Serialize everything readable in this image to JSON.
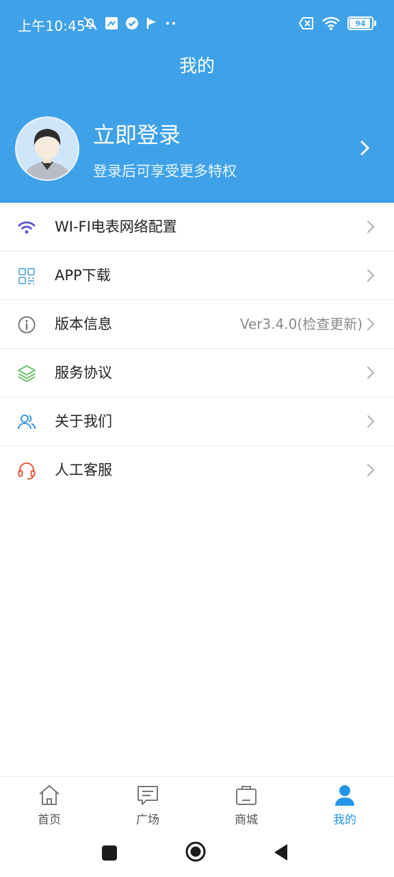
{
  "status_bar": {
    "time": "上午10:45",
    "battery_level": 94,
    "battery_text": "94"
  },
  "header": {
    "title": "我的"
  },
  "profile": {
    "login_title": "立即登录",
    "login_subtitle": "登录后可享受更多特权"
  },
  "menu": {
    "items": [
      {
        "label": "WI-FI电表网络配置",
        "icon": "wifi-icon",
        "value": ""
      },
      {
        "label": "APP下载",
        "icon": "qr-code-icon",
        "value": ""
      },
      {
        "label": "版本信息",
        "icon": "info-icon",
        "value": "Ver3.4.0(检查更新)"
      },
      {
        "label": "服务协议",
        "icon": "layers-icon",
        "value": ""
      },
      {
        "label": "关于我们",
        "icon": "users-icon",
        "value": ""
      },
      {
        "label": "人工客服",
        "icon": "headset-icon",
        "value": ""
      }
    ]
  },
  "tabbar": {
    "tabs": [
      {
        "label": "首页",
        "icon": "home-icon",
        "active": false
      },
      {
        "label": "广场",
        "icon": "chat-icon",
        "active": false
      },
      {
        "label": "商城",
        "icon": "shop-icon",
        "active": false
      },
      {
        "label": "我的",
        "icon": "person-icon",
        "active": true
      }
    ]
  },
  "colors": {
    "header_bg": "#3fa2e9",
    "accent": "#2196e9",
    "wifi_icon": "#5a4fd6",
    "qr_icon": "#6fb3e8",
    "info_icon": "#777777",
    "layers_icon": "#6cc26c",
    "users_icon": "#3a97e0",
    "headset_icon": "#e2553a"
  }
}
